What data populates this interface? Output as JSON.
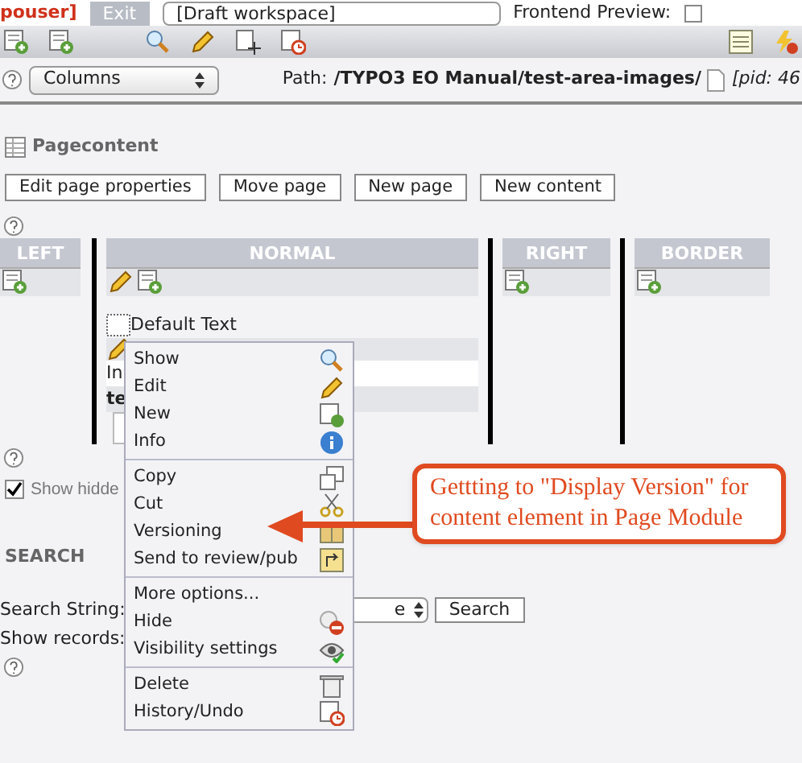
{
  "topbar": {
    "user": "pouser]",
    "exit": "Exit",
    "workspace": "[Draft workspace]",
    "preview_label": "Frontend Preview:",
    "preview_checked": false
  },
  "path_row": {
    "view": "Columns",
    "path_label": "Path:",
    "path": "/TYPO3 EO Manual/test-area-images/",
    "pid": "[pid: 46"
  },
  "section_title": "Pagecontent",
  "buttons": [
    "Edit page properties",
    "Move page",
    "New page",
    "New content"
  ],
  "columns": [
    {
      "label": "LEFT",
      "edit": false
    },
    {
      "label": "NORMAL",
      "edit": true
    },
    {
      "label": "RIGHT",
      "edit": false
    },
    {
      "label": "BORDER",
      "edit": false
    }
  ],
  "content_element": {
    "title": "Default Text",
    "line_1": "In",
    "line_2": "te"
  },
  "show_hidden": {
    "label": "Show hidde",
    "checked": true
  },
  "search": {
    "title": "SEARCH",
    "string_label": "Search String:",
    "records_label": "Show records:",
    "select_value": "e",
    "button": "Search"
  },
  "context_menu": [
    {
      "label": "Show",
      "kind": "search",
      "separator_after": false
    },
    {
      "label": "Edit",
      "kind": "pencil",
      "separator_after": false
    },
    {
      "label": "New",
      "kind": "new",
      "separator_after": false
    },
    {
      "label": "Info",
      "kind": "info",
      "separator_after": true
    },
    {
      "label": "Copy",
      "kind": "copy",
      "separator_after": false
    },
    {
      "label": "Cut",
      "kind": "cut",
      "separator_after": false
    },
    {
      "label": "Versioning",
      "kind": "version",
      "separator_after": false
    },
    {
      "label": "Send to review/pub",
      "kind": "send",
      "separator_after": true
    },
    {
      "label": "More options...",
      "kind": "plain",
      "separator_after": false
    },
    {
      "label": "Hide",
      "kind": "hide",
      "separator_after": false
    },
    {
      "label": "Visibility settings",
      "kind": "eye",
      "separator_after": true
    },
    {
      "label": "Delete",
      "kind": "trash",
      "separator_after": false
    },
    {
      "label": "History/Undo",
      "kind": "history",
      "separator_after": false
    }
  ],
  "callout": "Gettting to \"Display Version\" for content element in Page Module"
}
